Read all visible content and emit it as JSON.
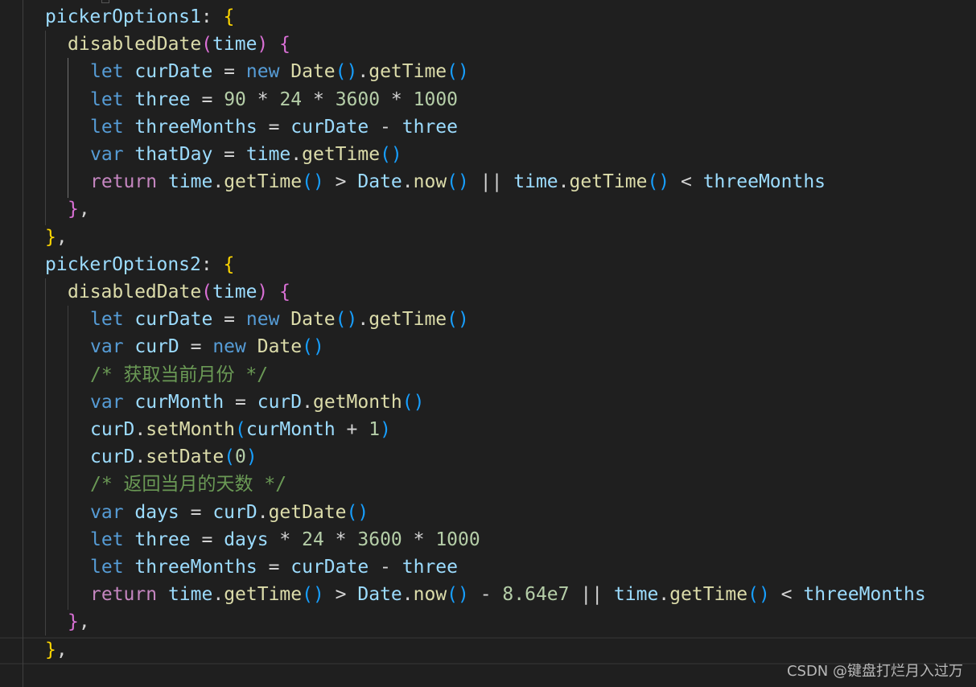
{
  "editor": {
    "lines": [
      [
        [
          "p",
          "pickerOptions1"
        ],
        [
          "o",
          ": "
        ],
        [
          "b1",
          "{"
        ]
      ],
      [
        [
          "f",
          "disabledDate"
        ],
        [
          "b2",
          "("
        ],
        [
          "p",
          "time"
        ],
        [
          "b2",
          ")"
        ],
        [
          "o",
          " "
        ],
        [
          "b2",
          "{"
        ]
      ],
      [
        [
          "k",
          "let "
        ],
        [
          "p",
          "curDate"
        ],
        [
          "o",
          " = "
        ],
        [
          "k",
          "new "
        ],
        [
          "f",
          "Date"
        ],
        [
          "b3",
          "()"
        ],
        [
          "o",
          "."
        ],
        [
          "f",
          "getTime"
        ],
        [
          "b3",
          "()"
        ]
      ],
      [
        [
          "k",
          "let "
        ],
        [
          "p",
          "three"
        ],
        [
          "o",
          " = "
        ],
        [
          "n",
          "90"
        ],
        [
          "o",
          " * "
        ],
        [
          "n",
          "24"
        ],
        [
          "o",
          " * "
        ],
        [
          "n",
          "3600"
        ],
        [
          "o",
          " * "
        ],
        [
          "n",
          "1000"
        ]
      ],
      [
        [
          "k",
          "let "
        ],
        [
          "p",
          "threeMonths"
        ],
        [
          "o",
          " = "
        ],
        [
          "p",
          "curDate"
        ],
        [
          "o",
          " - "
        ],
        [
          "p",
          "three"
        ]
      ],
      [
        [
          "k",
          "var "
        ],
        [
          "p",
          "thatDay"
        ],
        [
          "o",
          " = "
        ],
        [
          "p",
          "time"
        ],
        [
          "o",
          "."
        ],
        [
          "f",
          "getTime"
        ],
        [
          "b3",
          "()"
        ]
      ],
      [
        [
          "c",
          "return "
        ],
        [
          "p",
          "time"
        ],
        [
          "o",
          "."
        ],
        [
          "f",
          "getTime"
        ],
        [
          "b3",
          "()"
        ],
        [
          "o",
          " > "
        ],
        [
          "p",
          "Date"
        ],
        [
          "o",
          "."
        ],
        [
          "f",
          "now"
        ],
        [
          "b3",
          "()"
        ],
        [
          "o",
          " || "
        ],
        [
          "p",
          "time"
        ],
        [
          "o",
          "."
        ],
        [
          "f",
          "getTime"
        ],
        [
          "b3",
          "()"
        ],
        [
          "o",
          " < "
        ],
        [
          "p",
          "threeMonths"
        ]
      ],
      [
        [
          "b2",
          "}"
        ],
        [
          "o",
          ","
        ]
      ],
      [
        [
          "b1",
          "}"
        ],
        [
          "o",
          ","
        ]
      ],
      [
        [
          "p",
          "pickerOptions2"
        ],
        [
          "o",
          ": "
        ],
        [
          "b1",
          "{"
        ]
      ],
      [
        [
          "f",
          "disabledDate"
        ],
        [
          "b2",
          "("
        ],
        [
          "p",
          "time"
        ],
        [
          "b2",
          ")"
        ],
        [
          "o",
          " "
        ],
        [
          "b2",
          "{"
        ]
      ],
      [
        [
          "k",
          "let "
        ],
        [
          "p",
          "curDate"
        ],
        [
          "o",
          " = "
        ],
        [
          "k",
          "new "
        ],
        [
          "f",
          "Date"
        ],
        [
          "b3",
          "()"
        ],
        [
          "o",
          "."
        ],
        [
          "f",
          "getTime"
        ],
        [
          "b3",
          "()"
        ]
      ],
      [
        [
          "k",
          "var "
        ],
        [
          "p",
          "curD"
        ],
        [
          "o",
          " = "
        ],
        [
          "k",
          "new "
        ],
        [
          "f",
          "Date"
        ],
        [
          "b3",
          "()"
        ]
      ],
      [
        [
          "cm",
          "/* 获取当前月份 */"
        ]
      ],
      [
        [
          "k",
          "var "
        ],
        [
          "p",
          "curMonth"
        ],
        [
          "o",
          " = "
        ],
        [
          "p",
          "curD"
        ],
        [
          "o",
          "."
        ],
        [
          "f",
          "getMonth"
        ],
        [
          "b3",
          "()"
        ]
      ],
      [
        [
          "p",
          "curD"
        ],
        [
          "o",
          "."
        ],
        [
          "f",
          "setMonth"
        ],
        [
          "b3",
          "("
        ],
        [
          "p",
          "curMonth"
        ],
        [
          "o",
          " + "
        ],
        [
          "n",
          "1"
        ],
        [
          "b3",
          ")"
        ]
      ],
      [
        [
          "p",
          "curD"
        ],
        [
          "o",
          "."
        ],
        [
          "f",
          "setDate"
        ],
        [
          "b3",
          "("
        ],
        [
          "n",
          "0"
        ],
        [
          "b3",
          ")"
        ]
      ],
      [
        [
          "cm",
          "/* 返回当月的天数 */"
        ]
      ],
      [
        [
          "k",
          "var "
        ],
        [
          "p",
          "days"
        ],
        [
          "o",
          " = "
        ],
        [
          "p",
          "curD"
        ],
        [
          "o",
          "."
        ],
        [
          "f",
          "getDate"
        ],
        [
          "b3",
          "()"
        ]
      ],
      [
        [
          "k",
          "let "
        ],
        [
          "p",
          "three"
        ],
        [
          "o",
          " = "
        ],
        [
          "p",
          "days"
        ],
        [
          "o",
          " * "
        ],
        [
          "n",
          "24"
        ],
        [
          "o",
          " * "
        ],
        [
          "n",
          "3600"
        ],
        [
          "o",
          " * "
        ],
        [
          "n",
          "1000"
        ]
      ],
      [
        [
          "k",
          "let "
        ],
        [
          "p",
          "threeMonths"
        ],
        [
          "o",
          " = "
        ],
        [
          "p",
          "curDate"
        ],
        [
          "o",
          " - "
        ],
        [
          "p",
          "three"
        ]
      ],
      [
        [
          "c",
          "return "
        ],
        [
          "p",
          "time"
        ],
        [
          "o",
          "."
        ],
        [
          "f",
          "getTime"
        ],
        [
          "b3",
          "()"
        ],
        [
          "o",
          " > "
        ],
        [
          "p",
          "Date"
        ],
        [
          "o",
          "."
        ],
        [
          "f",
          "now"
        ],
        [
          "b3",
          "()"
        ],
        [
          "o",
          " - "
        ],
        [
          "n",
          "8.64e7"
        ],
        [
          "o",
          " || "
        ],
        [
          "p",
          "time"
        ],
        [
          "o",
          "."
        ],
        [
          "f",
          "getTime"
        ],
        [
          "b3",
          "()"
        ],
        [
          "o",
          " < "
        ],
        [
          "p",
          "threeMonths"
        ]
      ],
      [
        [
          "b2",
          "}"
        ],
        [
          "o",
          ","
        ]
      ],
      [
        [
          "b1",
          "}"
        ],
        [
          "o",
          ","
        ]
      ]
    ]
  },
  "watermark": "CSDN @键盘打烂月入过万"
}
